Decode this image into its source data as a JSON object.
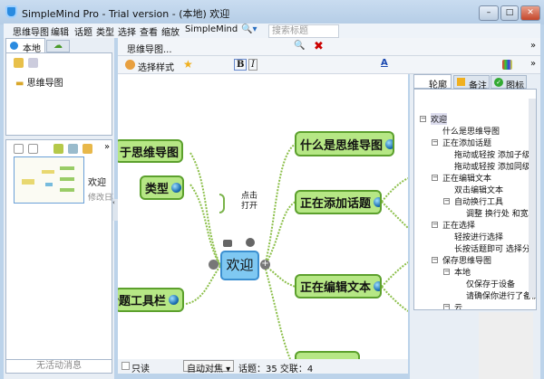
{
  "window": {
    "title": "SimpleMind Pro - Trial version - (本地) 欢迎",
    "min": "–",
    "max": "□",
    "close": "✕"
  },
  "menu": [
    "思维导图",
    "编辑",
    "话题",
    "类型",
    "选择",
    "查看",
    "缩放",
    "SimpleMind"
  ],
  "search": {
    "placeholder": "搜索标题"
  },
  "left": {
    "tab_local": "本地",
    "tree_item": "思维导图",
    "thumb_title": "欢迎",
    "thumb_sub": "修改日期",
    "status": "无活动消息"
  },
  "toolbar": {
    "mindmap_menu": "思维导图...",
    "style_select": "选择样式",
    "more": "»"
  },
  "canvas": {
    "center": "欢迎",
    "left_nodes": [
      "于思维导图",
      "类型",
      "话题工具栏"
    ],
    "right_nodes": [
      "什么是思维导图",
      "正在添加话题",
      "正在编辑文本"
    ],
    "hint_line1": "点击",
    "hint_line2": "打开"
  },
  "bottom": {
    "readonly": "只读",
    "autofocus": "自动对焦",
    "stats": "话题：35 交联：4"
  },
  "right": {
    "tabs": [
      "轮廓",
      "备注",
      "图标"
    ],
    "outline": [
      {
        "t": "欢迎",
        "l": 0,
        "e": true
      },
      {
        "t": "什么是思维导图",
        "l": 1
      },
      {
        "t": "正在添加话题",
        "l": 1,
        "e": true
      },
      {
        "t": "拖动或轻按 添加子级",
        "l": 2
      },
      {
        "t": "拖动或轻按 添加同级",
        "l": 2
      },
      {
        "t": "正在编辑文本",
        "l": 1,
        "e": true
      },
      {
        "t": "双击编辑文本",
        "l": 2
      },
      {
        "t": "自动换行工具",
        "l": 2,
        "e": true
      },
      {
        "t": "调整 换行处 和宽度",
        "l": 3
      },
      {
        "t": "正在选择",
        "l": 1,
        "e": true
      },
      {
        "t": "轻按进行选择",
        "l": 2
      },
      {
        "t": "长按话题即可 选择分支",
        "l": 2
      },
      {
        "t": "保存思维导图",
        "l": 1,
        "e": true
      },
      {
        "t": "本地",
        "l": 2,
        "e": true
      },
      {
        "t": "仅保存于设备",
        "l": 3
      },
      {
        "t": "请确保你进行了备份",
        "l": 3
      },
      {
        "t": "云",
        "l": 2,
        "e": true
      }
    ]
  },
  "colors": {
    "node_fill": "#b6e785",
    "node_border": "#5ca02d",
    "center_fill": "#7fc8f2"
  }
}
